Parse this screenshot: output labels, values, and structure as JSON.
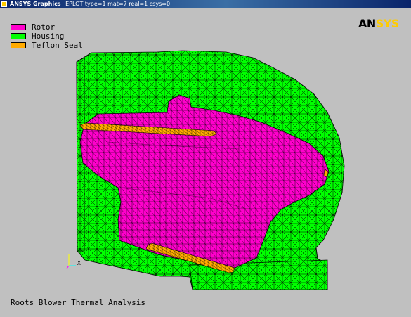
{
  "window": {
    "app_title": "ANSYS Graphics",
    "plot_info": "EPLOT  type=1 mat=7 real=1 csys=0"
  },
  "logo": {
    "part1": "AN",
    "part2": "SYS"
  },
  "legend": [
    {
      "label": "Rotor",
      "color": "#ff00cc"
    },
    {
      "label": "Housing",
      "color": "#00ff00"
    },
    {
      "label": "Teflon Seal",
      "color": "#ffaa00"
    }
  ],
  "triad": {
    "x_label": "X"
  },
  "footer_title": "Roots Blower Thermal Analysis",
  "colors": {
    "background": "#c0c0c0",
    "rotor": "#ff00cc",
    "housing": "#00ff00",
    "seal": "#ffaa00",
    "mesh_line": "#000000"
  }
}
